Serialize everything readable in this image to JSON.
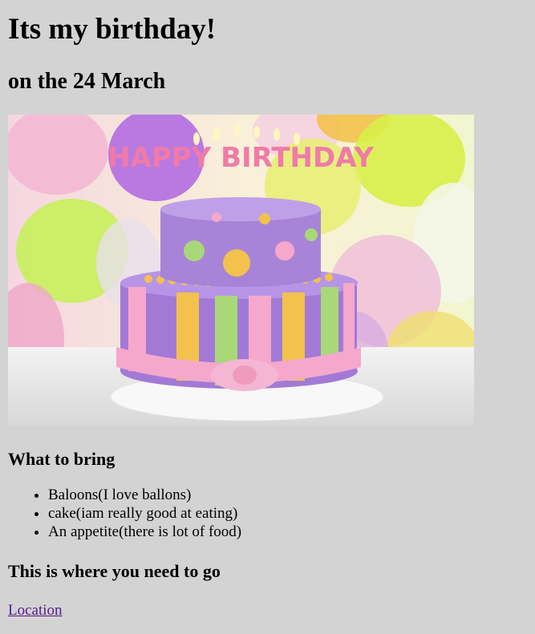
{
  "page": {
    "title": "Its my birthday!",
    "date_line": "on the 24 March",
    "image_alt": "Birthday cake",
    "cake_candles_text": "HAPPY BIRTHDAY",
    "bring_heading": "What to bring",
    "bring_items": [
      "Baloons(I love ballons)",
      "cake(iam really good at eating)",
      "An appetite(there is lot of food)"
    ],
    "go_heading": "This is where you need to go",
    "location_link": "Location"
  },
  "colors": {
    "background": "#d3d3d3",
    "link_visited": "#551a8b"
  }
}
